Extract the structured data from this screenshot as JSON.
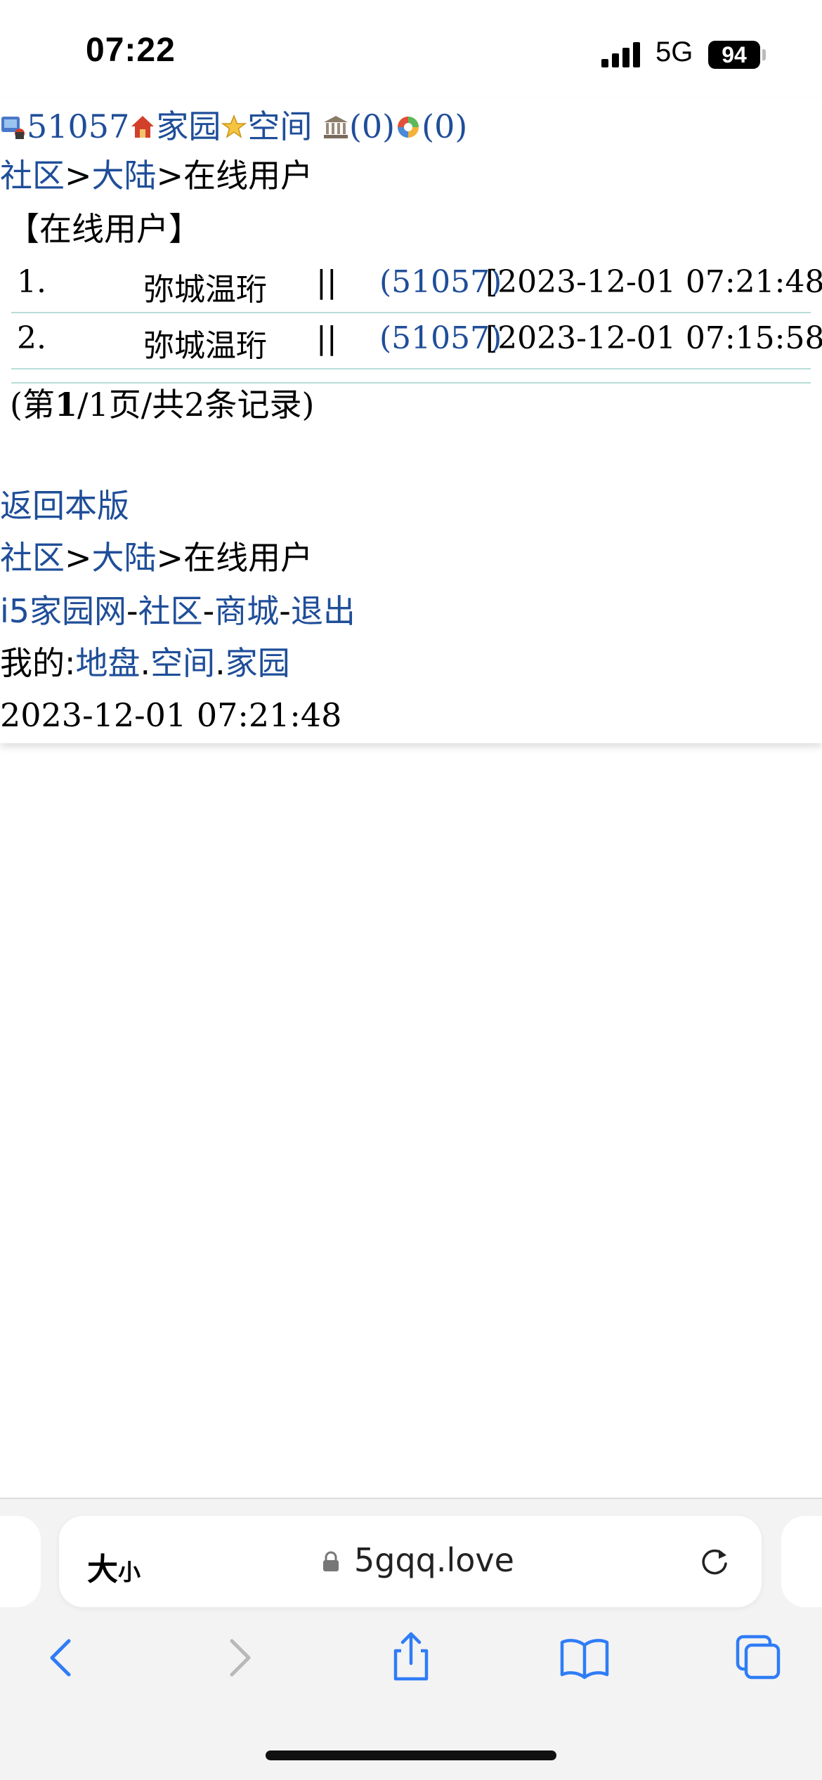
{
  "status_bar": {
    "time": "07:22",
    "network": "5G",
    "battery": "94"
  },
  "header": {
    "user_id": "51057",
    "home_label": "家园",
    "space_label": "空间",
    "bank_count": "(0)",
    "photo_count": "(0)"
  },
  "breadcrumb": {
    "community": "社区",
    "sep1": ">",
    "region": "大陆",
    "sep2": ">",
    "current": "在线用户"
  },
  "section_title": "【在线用户】",
  "online_users": [
    {
      "index": "1.",
      "name": "弥城温珩",
      "sep": "||",
      "uid": "(51057)",
      "time": "[2023-12-01 07:21:48]"
    },
    {
      "index": "2.",
      "name": "弥城温珩",
      "sep": "||",
      "uid": "(51057)",
      "time": "[2023-12-01 07:15:58]"
    }
  ],
  "pagination": {
    "prefix": "(第",
    "page": "1",
    "suffix": "/1页/共2条记录)"
  },
  "footer": {
    "back_label": "返回本版",
    "crumb_community": "社区",
    "crumb_sep1": ">",
    "crumb_region": "大陆",
    "crumb_sep2": ">",
    "crumb_current": "在线用户",
    "site_label": "i5家园网",
    "dash1": "-",
    "community_label": "社区",
    "dash2": "-",
    "mall_label": "商城",
    "dash3": "-",
    "logout_label": "退出",
    "mine_prefix": "我的:",
    "land_label": "地盘",
    "dot1": ".",
    "space_label": "空间",
    "dot2": ".",
    "home_label": "家园",
    "timestamp": "2023-12-01 07:21:48"
  },
  "browser": {
    "text_size_label": "大",
    "text_size_small": "小",
    "domain": "5gqq.love",
    "icons": [
      "back-icon",
      "forward-icon",
      "share-icon",
      "bookmarks-icon",
      "tabs-icon"
    ]
  }
}
